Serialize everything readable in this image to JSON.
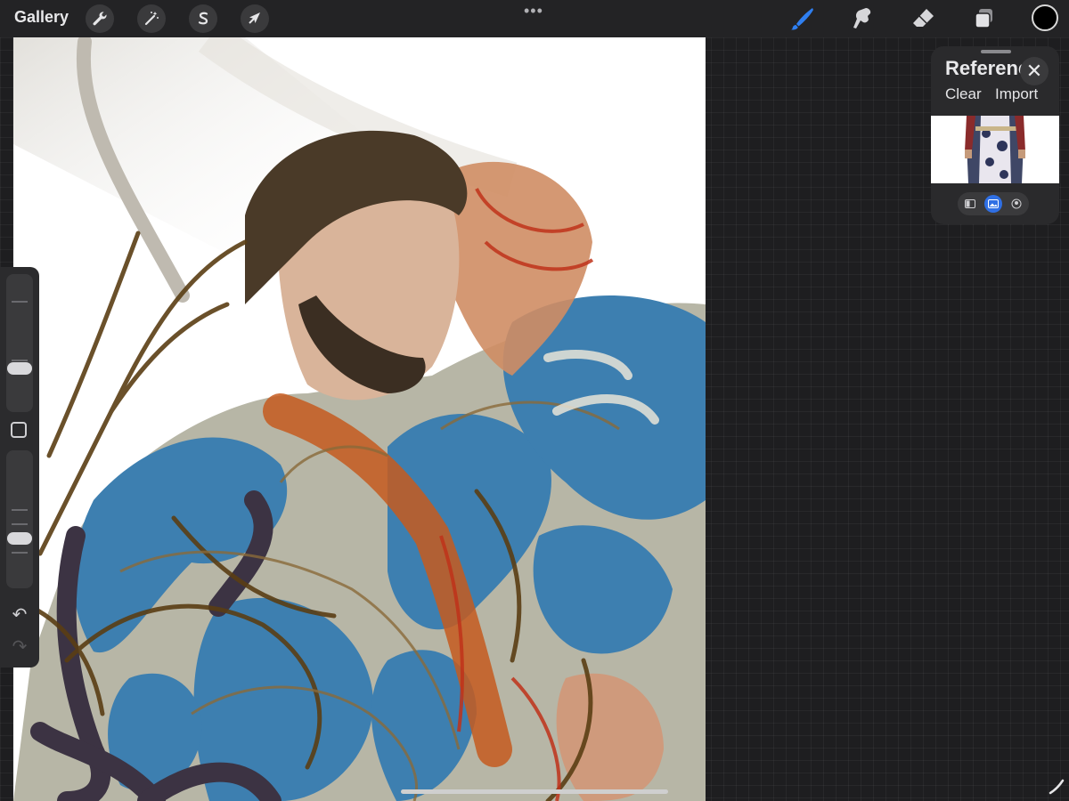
{
  "app": {
    "gallery_label": "Gallery"
  },
  "top_tools": [
    {
      "name": "wrench",
      "icon": "wrench-icon"
    },
    {
      "name": "adjustments",
      "icon": "magic-wand-icon"
    },
    {
      "name": "selection",
      "icon": "selection-s-icon"
    },
    {
      "name": "transform",
      "icon": "arrow-cursor-icon"
    }
  ],
  "more_label": "•••",
  "right_tools": [
    {
      "name": "brush",
      "icon": "brush-icon",
      "active": true
    },
    {
      "name": "smudge",
      "icon": "smudge-icon",
      "active": false
    },
    {
      "name": "eraser",
      "icon": "eraser-icon",
      "active": false
    },
    {
      "name": "layers",
      "icon": "layers-icon",
      "active": false
    }
  ],
  "colors": {
    "active_tool": "#2f7ff0",
    "current_color": "#000000",
    "topbar": "#232325",
    "workspace": "#1e1e20"
  },
  "reference": {
    "title": "Reference",
    "clear_label": "Clear",
    "import_label": "Import",
    "modes": [
      "canvas-icon",
      "image-icon",
      "face-icon"
    ],
    "active_mode": 1
  },
  "sidebar": {
    "brush_size_level": 0.3,
    "opacity_level": 0.35,
    "undo_icon": "undo-icon",
    "redo_icon": "redo-icon"
  }
}
